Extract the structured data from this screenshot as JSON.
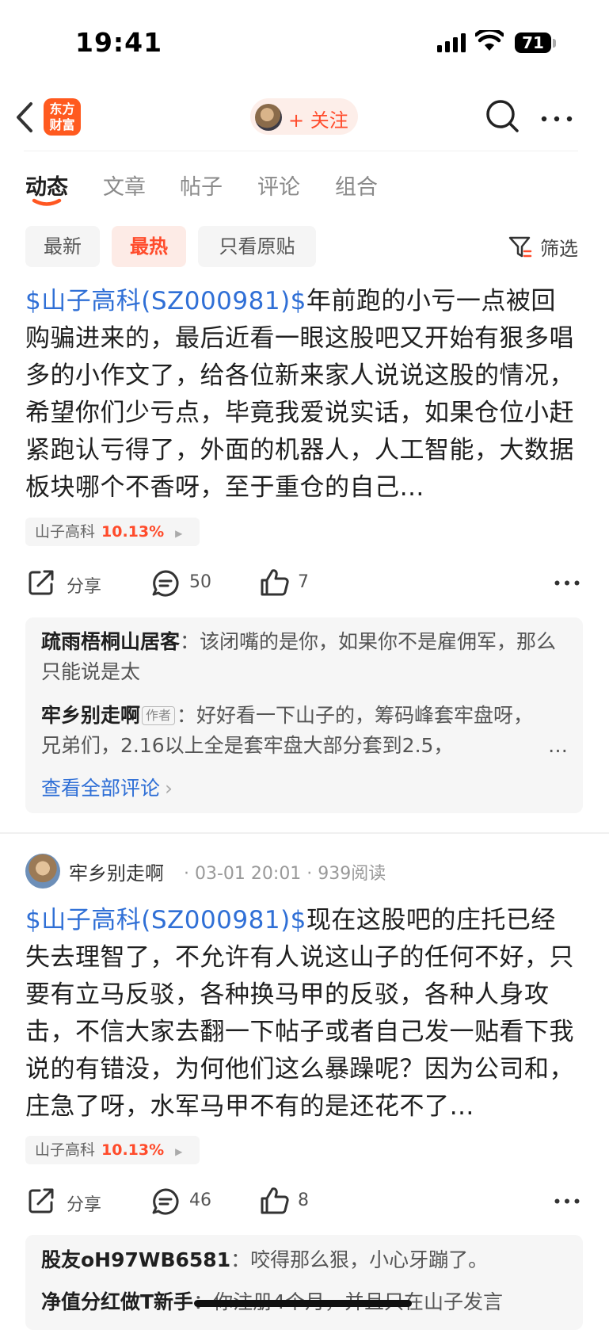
{
  "status": {
    "time": "19:41",
    "battery": "71"
  },
  "nav": {
    "logo_line1": "东方",
    "logo_line2": "财富",
    "follow_label": "+ 关注"
  },
  "tabs": [
    "动态",
    "文章",
    "帖子",
    "评论",
    "组合"
  ],
  "filters": {
    "chips": [
      "最新",
      "最热",
      "只看原贴"
    ],
    "filter_label": "筛选"
  },
  "posts": [
    {
      "tag": "$山子高科(SZ000981)$",
      "body": "年前跑的小亏一点被回购骗进来的，最后近看一眼这股吧又开始有狠多唱多的小作文了，给各位新来家人说说这股的情况，希望你们少亏点，毕竟我爱说实话，如果仓位小赶紧跑认亏得了，外面的机器人，人工智能，大数据板块哪个不香呀，至于重仓的自己…",
      "stock": {
        "name": "山子高科",
        "change": "10.13%"
      },
      "actions": {
        "share": "分享",
        "comments": "50",
        "likes": "7"
      },
      "comments": [
        {
          "user": "疏雨梧桐山居客",
          "author_tag": "",
          "text": "：该闭嘴的是你，如果你不是雇佣军，那么只能说是太"
        },
        {
          "user": "牢乡别走啊",
          "author_tag": "作者",
          "text": "：好好看一下山子的，筹码峰套牢盘呀，兄弟们，2.16以上全是套牢盘大部分套到2.5，",
          "ellipsis": "…"
        }
      ],
      "view_all": "查看全部评论"
    },
    {
      "author": "牢乡别走啊",
      "meta": "· 03-01 20:01 · 939阅读",
      "tag": "$山子高科(SZ000981)$",
      "body": "现在这股吧的庄托已经失去理智了，不允许有人说这山子的任何不好，只要有立马反驳，各种换马甲的反驳，各种人身攻击，不信大家去翻一下帖子或者自己发一贴看下我说的有错没，为何他们这么暴躁呢？因为公司和，庄急了呀，水军马甲不有的是还花不了…",
      "stock": {
        "name": "山子高科",
        "change": "10.13%"
      },
      "actions": {
        "share": "分享",
        "comments": "46",
        "likes": "8"
      },
      "comments": [
        {
          "user": "股友oH97WB6581",
          "text": "：咬得那么狠，小心牙蹦了。"
        },
        {
          "user": "净值分红做T新手",
          "text": "：你注册4个月，并且只在山子发言"
        }
      ]
    }
  ]
}
